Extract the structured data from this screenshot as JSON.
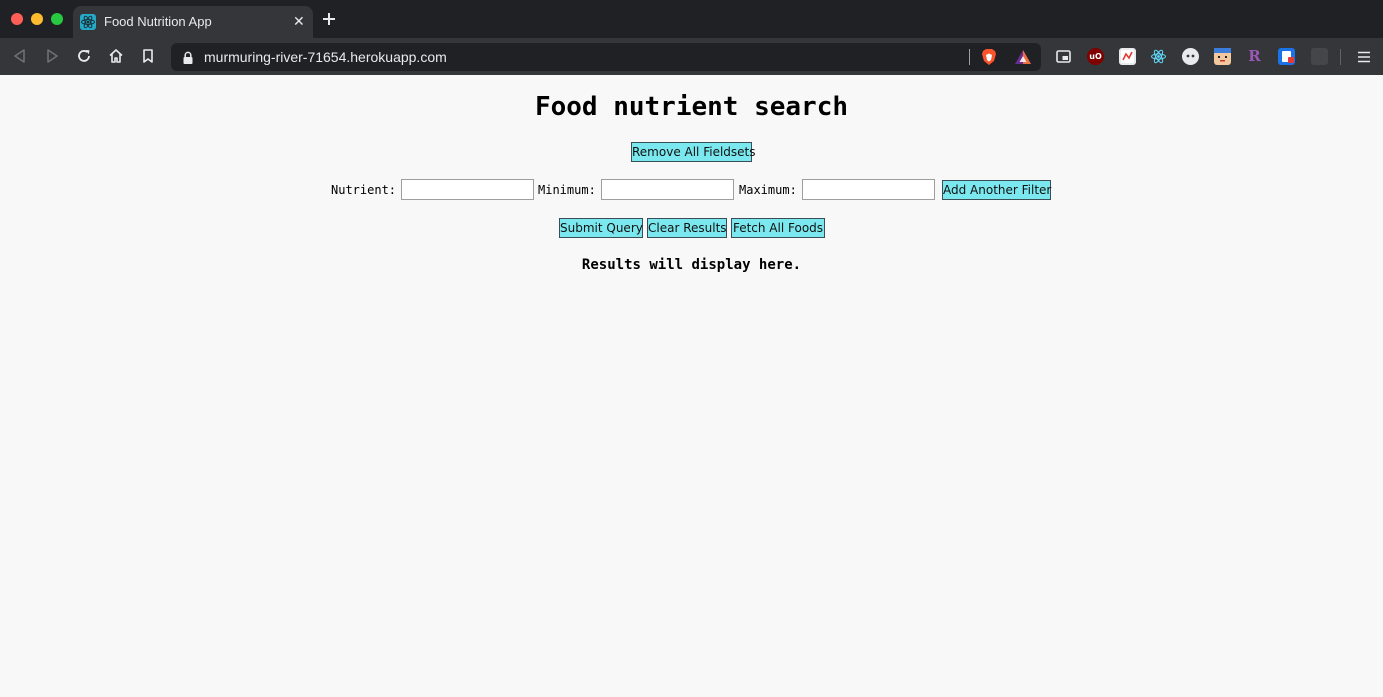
{
  "browser": {
    "tab_title": "Food Nutrition App",
    "tab_close": "✕",
    "url": "murmuring-river-71654.herokuapp.com",
    "accent": "#24a9c6",
    "extensions": [
      {
        "name": "picture-in-picture-icon",
        "glyph": "",
        "color": "#35363a"
      },
      {
        "name": "ublock-origin-icon",
        "glyph": "uO",
        "color": "#800000"
      },
      {
        "name": "pdf-tool-icon",
        "glyph": "",
        "color": "#e8eaed"
      },
      {
        "name": "react-devtools-icon",
        "glyph": "",
        "color": "#35363a"
      },
      {
        "name": "dark-reader-icon",
        "glyph": "",
        "color": "#e8eaed"
      },
      {
        "name": "character-avatar-icon",
        "glyph": "",
        "color": "#f3c89e"
      },
      {
        "name": "r-extension-icon",
        "glyph": "R",
        "color": "#35363a"
      },
      {
        "name": "clipboard-extension-icon",
        "glyph": "",
        "color": "#1a73e8"
      },
      {
        "name": "inactive-extension-icon",
        "glyph": "",
        "color": "#45464a"
      }
    ]
  },
  "page": {
    "title": "Food nutrient search",
    "remove_fieldsets_label": "Remove All Fieldsets",
    "filter": {
      "nutrient_label": "Nutrient:",
      "nutrient_value": "",
      "minimum_label": "Minimum:",
      "minimum_value": "",
      "maximum_label": "Maximum:",
      "maximum_value": "",
      "add_filter_label": "Add Another Filter"
    },
    "actions": {
      "submit_label": "Submit Query",
      "clear_label": "Clear Results",
      "fetch_label": "Fetch All Foods"
    },
    "results_placeholder": "Results will display here.",
    "button_color": "#7ae8ee"
  }
}
